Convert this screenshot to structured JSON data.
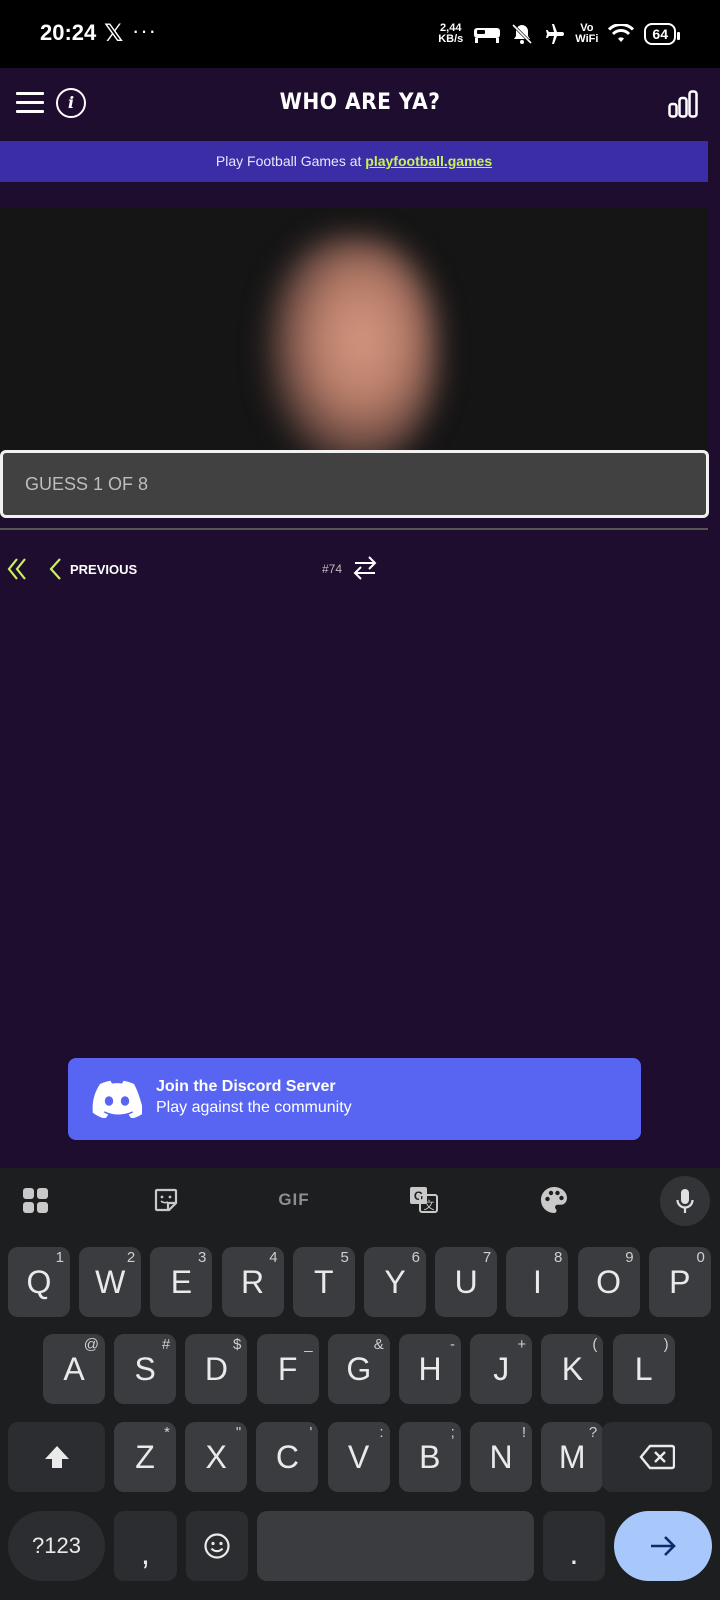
{
  "status_bar": {
    "time": "20:24",
    "x_icon": "x-logo",
    "more": "···",
    "speed_top": "2,44",
    "speed_bottom": "KB/s",
    "vo": "Vo",
    "wifi_label": "WiFi",
    "battery": "64"
  },
  "header": {
    "title": "WHO ARE YA?"
  },
  "banner": {
    "text": "Play Football Games at ",
    "link": "playfootball.games"
  },
  "guess_input": {
    "placeholder": "GUESS 1 OF 8"
  },
  "nav": {
    "previous_label": "PREVIOUS",
    "game_number": "#74"
  },
  "discord": {
    "title": "Join the Discord Server",
    "subtitle": "Play against the community"
  },
  "keyboard": {
    "tools": [
      "apps-icon",
      "sticker-icon",
      "GIF",
      "translate-icon",
      "palette-icon",
      "mic-icon"
    ],
    "gif_label": "GIF",
    "row1": [
      {
        "k": "Q",
        "h": "1"
      },
      {
        "k": "W",
        "h": "2"
      },
      {
        "k": "E",
        "h": "3"
      },
      {
        "k": "R",
        "h": "4"
      },
      {
        "k": "T",
        "h": "5"
      },
      {
        "k": "Y",
        "h": "6"
      },
      {
        "k": "U",
        "h": "7"
      },
      {
        "k": "I",
        "h": "8"
      },
      {
        "k": "O",
        "h": "9"
      },
      {
        "k": "P",
        "h": "0"
      }
    ],
    "row2": [
      {
        "k": "A",
        "h": "@"
      },
      {
        "k": "S",
        "h": "#"
      },
      {
        "k": "D",
        "h": "$"
      },
      {
        "k": "F",
        "h": "_"
      },
      {
        "k": "G",
        "h": "&"
      },
      {
        "k": "H",
        "h": "-"
      },
      {
        "k": "J",
        "h": "+"
      },
      {
        "k": "K",
        "h": "("
      },
      {
        "k": "L",
        "h": ")"
      }
    ],
    "row3": [
      {
        "k": "Z",
        "h": "*"
      },
      {
        "k": "X",
        "h": "\""
      },
      {
        "k": "C",
        "h": "'"
      },
      {
        "k": "V",
        "h": ":"
      },
      {
        "k": "B",
        "h": ";"
      },
      {
        "k": "N",
        "h": "!"
      },
      {
        "k": "M",
        "h": "?"
      }
    ],
    "sym_label": "?123",
    "comma": ",",
    "period": "."
  }
}
